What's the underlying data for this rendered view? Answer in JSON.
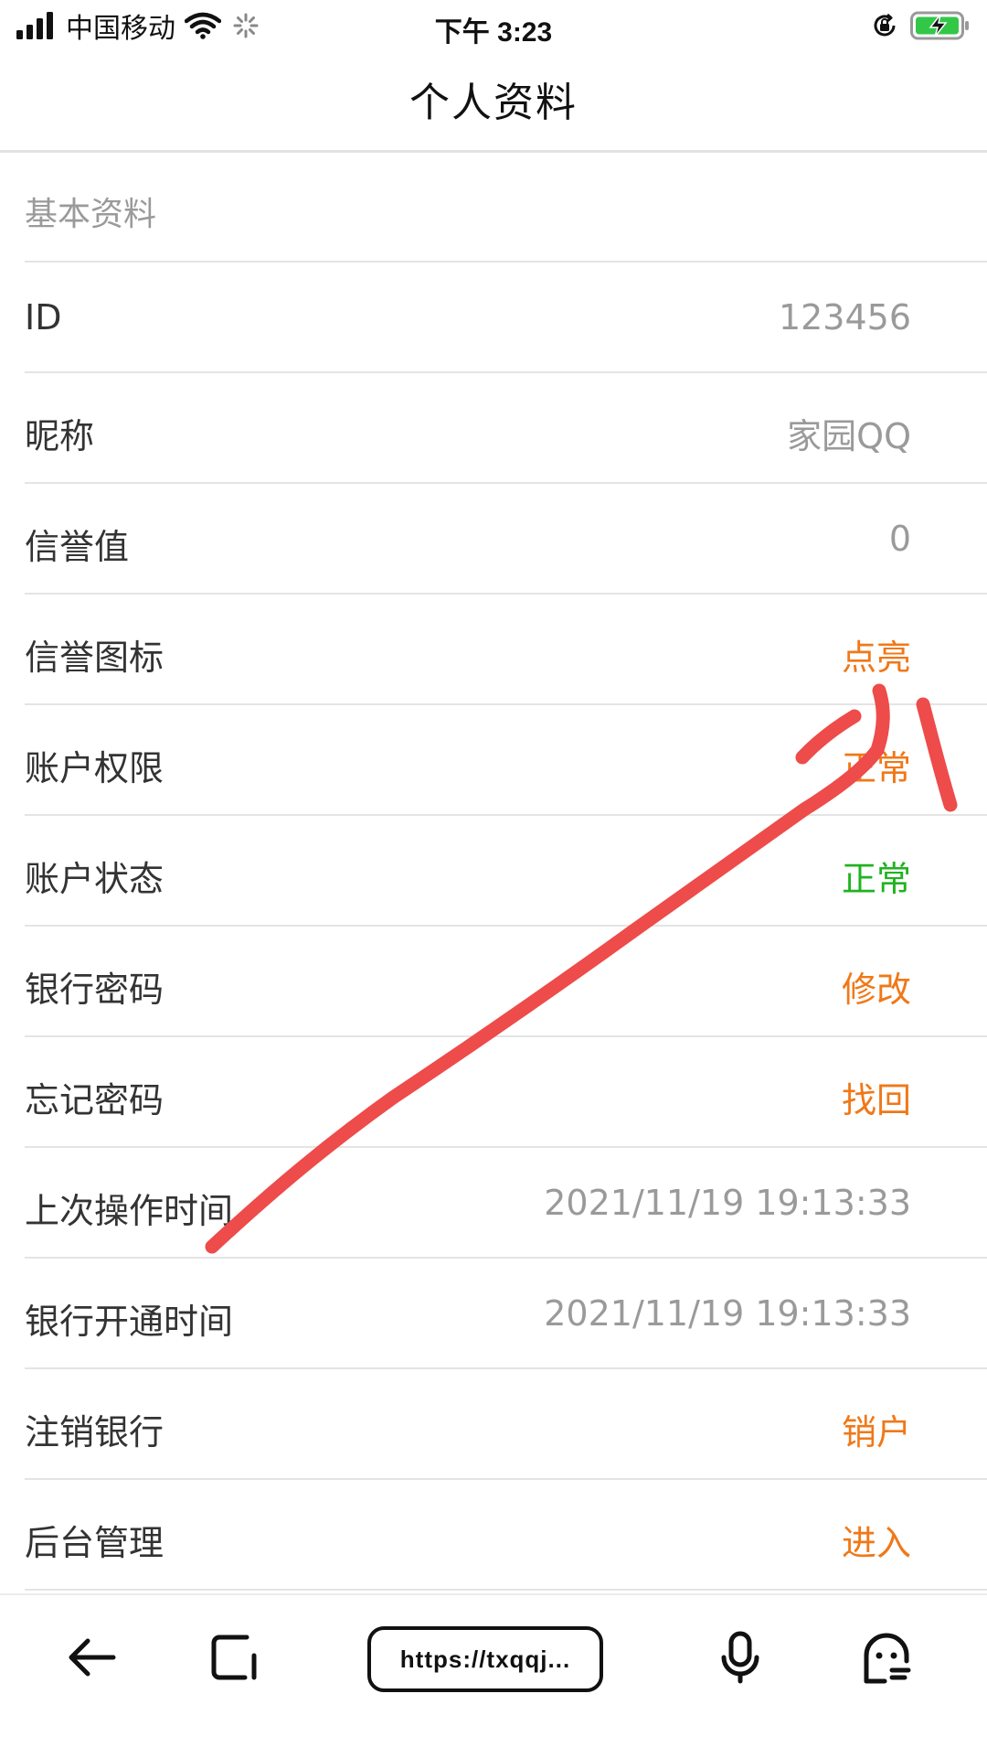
{
  "status_bar": {
    "carrier": "中国移动",
    "time": "下午 3:23"
  },
  "header": {
    "title": "个人资料"
  },
  "section": {
    "title": "基本资料"
  },
  "rows": [
    {
      "label": "ID",
      "value": "123456"
    },
    {
      "label": "昵称",
      "value": "家园QQ"
    },
    {
      "label": "信誉值",
      "value": "0"
    },
    {
      "label": "信誉图标",
      "value": "点亮"
    },
    {
      "label": "账户权限",
      "value": "正常"
    },
    {
      "label": "账户状态",
      "value": "正常"
    },
    {
      "label": "银行密码",
      "value": "修改"
    },
    {
      "label": "忘记密码",
      "value": "找回"
    },
    {
      "label": "上次操作时间",
      "value": "2021/11/19 19:13:33"
    },
    {
      "label": "银行开通时间",
      "value": "2021/11/19 19:13:33"
    },
    {
      "label": "注销银行",
      "value": "销户"
    },
    {
      "label": "后台管理",
      "value": "进入"
    }
  ],
  "toolbar": {
    "url": "https://txqqj..."
  },
  "colors": {
    "gray_value": "#9a9a9a",
    "orange_action": "#f07818",
    "green_status": "#21b321",
    "annotation_red": "#ee4b4b"
  },
  "icons": {
    "signal": "signal-icon",
    "wifi": "wifi-icon",
    "loading": "loading-icon",
    "orientation_lock": "orientation-lock-icon",
    "battery": "battery-charging-icon",
    "back": "back-arrow-icon",
    "tabs": "tabs-icon",
    "voice": "microphone-icon",
    "assistant": "assistant-face-icon"
  }
}
